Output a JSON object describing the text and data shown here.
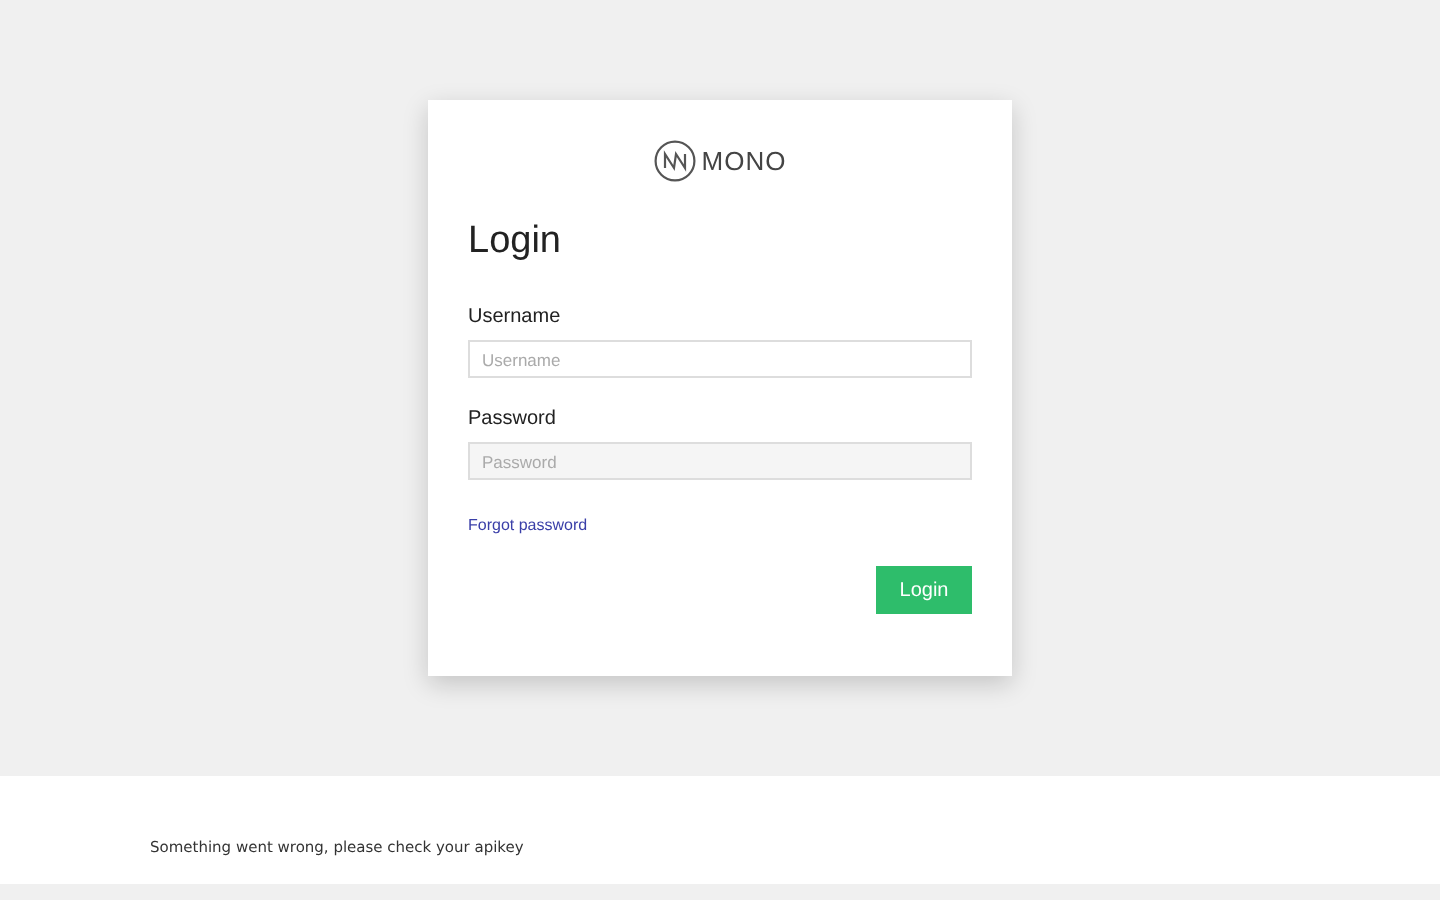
{
  "logo": {
    "text": "MONO"
  },
  "form": {
    "title": "Login",
    "fields": [
      {
        "label": "Username",
        "placeholder": "Username",
        "kind": "text"
      },
      {
        "label": "Password",
        "placeholder": "Password",
        "kind": "password"
      }
    ],
    "forgot_link": "Forgot password",
    "submit": "Login"
  },
  "error_message": "Something went wrong, please check your apikey"
}
